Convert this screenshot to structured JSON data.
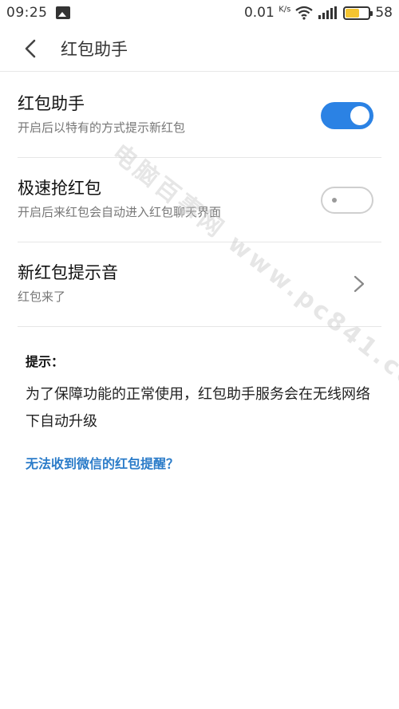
{
  "status_bar": {
    "time": "09:25",
    "net_speed": "0.01",
    "net_speed_unit": "K/s",
    "battery_level": "58",
    "battery_fill_percent": 58,
    "battery_fill_color": "#f4c430"
  },
  "app_bar": {
    "title": "红包助手"
  },
  "settings": {
    "items": [
      {
        "title": "红包助手",
        "subtitle": "开启后以特有的方式提示新红包",
        "control": "toggle",
        "enabled": true
      },
      {
        "title": "极速抢红包",
        "subtitle": "开启后来红包会自动进入红包聊天界面",
        "control": "toggle",
        "enabled": false
      },
      {
        "title": "新红包提示音",
        "subtitle": "红包来了",
        "control": "chevron"
      }
    ]
  },
  "tips": {
    "label": "提示：",
    "body": "为了保障功能的正常使用，红包助手服务会在无线网络下自动升级"
  },
  "help_link": "无法收到微信的红包提醒？",
  "watermark": "电脑百事网 www.pc841.com",
  "colors": {
    "accent": "#2b82e4",
    "link": "#2b7cc9"
  }
}
